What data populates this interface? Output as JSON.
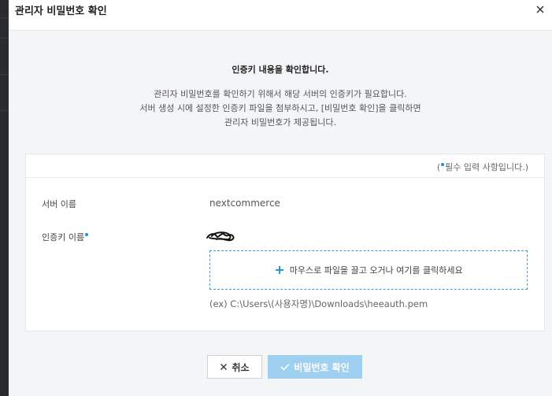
{
  "dialog": {
    "title": "관리자 비밀번호 확인",
    "intro_title": "인증키 내용을 확인합니다.",
    "intro_lines": [
      "관리자 비밀번호를 확인하기 위해서 해당 서버의 인증키가 필요합니다.",
      "서버 생성 시에 설정한 인증키 파일을 첨부하시고, [비밀번호 확인]을 클릭하면",
      "관리자 비밀번호가 제공됩니다."
    ]
  },
  "form": {
    "required_note_open": "(",
    "required_note_text": "필수 입력 사항입니다.)",
    "server_name_label": "서버 이름",
    "server_name_value": "nextcommerce",
    "key_name_label": "인증키 이름",
    "dropzone_text": "마우스로 파일을 끌고 오거나 여기를 클릭하세요",
    "example_path": "(ex) C:\\Users\\(사용자명)\\Downloads\\heeauth.pem"
  },
  "buttons": {
    "cancel_label": "취소",
    "confirm_label": "비밀번호 확인"
  },
  "colors": {
    "accent": "#1e8fd8",
    "confirm_disabled": "#9ed0f2"
  }
}
